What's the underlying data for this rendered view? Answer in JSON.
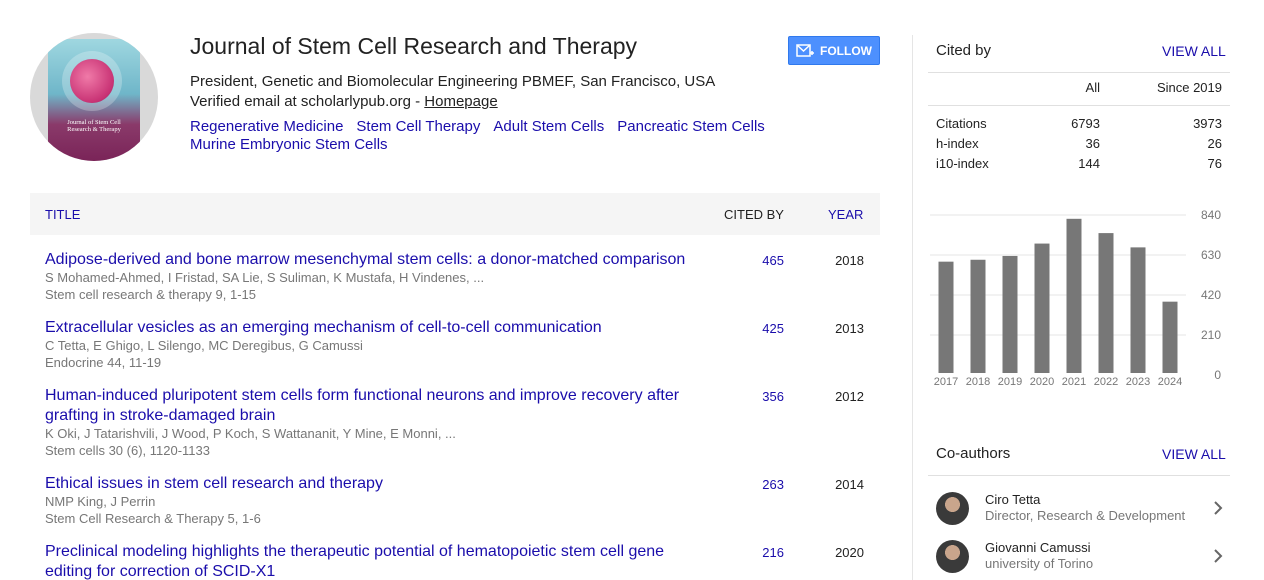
{
  "profile": {
    "name": "Journal of Stem Cell Research and Therapy",
    "affiliation": "President, Genetic and Biomolecular Engineering PBMEF, San Francisco, USA",
    "email_text": "Verified email at scholarlypub.org - ",
    "homepage_label": "Homepage",
    "cover_text": "Journal of Stem Cell Research & Therapy",
    "interests": [
      "Regenerative Medicine",
      "Stem Cell Therapy",
      "Adult Stem Cells",
      "Pancreatic Stem Cells",
      "Murine Embryonic Stem Cells"
    ],
    "follow_label": "FOLLOW"
  },
  "table": {
    "headers": {
      "title": "TITLE",
      "cited_by": "CITED BY",
      "year": "YEAR"
    },
    "rows": [
      {
        "title": "Adipose-derived and bone marrow mesenchymal stem cells: a donor-matched comparison",
        "authors": "S Mohamed-Ahmed, I Fristad, SA Lie, S Suliman, K Mustafa, H Vindenes, ...",
        "venue": "Stem cell research & therapy 9, 1-15",
        "cited": "465",
        "year": "2018"
      },
      {
        "title": "Extracellular vesicles as an emerging mechanism of cell-to-cell communication",
        "authors": "C Tetta, E Ghigo, L Silengo, MC Deregibus, G Camussi",
        "venue": "Endocrine 44, 11-19",
        "cited": "425",
        "year": "2013"
      },
      {
        "title": "Human-induced pluripotent stem cells form functional neurons and improve recovery after grafting in stroke-damaged brain",
        "authors": "K Oki, J Tatarishvili, J Wood, P Koch, S Wattananit, Y Mine, E Monni, ...",
        "venue": "Stem cells 30 (6), 1120-1133",
        "cited": "356",
        "year": "2012"
      },
      {
        "title": "Ethical issues in stem cell research and therapy",
        "authors": "NMP King, J Perrin",
        "venue": "Stem Cell Research & Therapy 5, 1-6",
        "cited": "263",
        "year": "2014"
      },
      {
        "title": "Preclinical modeling highlights the therapeutic potential of hematopoietic stem cell gene editing for correction of SCID-X1",
        "authors": "",
        "venue": "",
        "cited": "216",
        "year": "2020"
      }
    ]
  },
  "cited_by": {
    "title": "Cited by",
    "view_all": "VIEW ALL",
    "col_all": "All",
    "col_since": "Since 2019",
    "stats": [
      {
        "label": "Citations",
        "all": "6793",
        "since": "3973"
      },
      {
        "label": "h-index",
        "all": "36",
        "since": "26"
      },
      {
        "label": "i10-index",
        "all": "144",
        "since": "76"
      }
    ]
  },
  "chart_data": {
    "type": "bar",
    "categories": [
      "2017",
      "2018",
      "2019",
      "2020",
      "2021",
      "2022",
      "2023",
      "2024"
    ],
    "values": [
      595,
      605,
      625,
      690,
      820,
      745,
      670,
      385
    ],
    "yticks": [
      "840",
      "630",
      "420",
      "210",
      "0"
    ],
    "ylim": [
      0,
      840
    ],
    "bar_color": "#777777"
  },
  "coauthors": {
    "title": "Co-authors",
    "view_all": "VIEW ALL",
    "items": [
      {
        "name": "Ciro Tetta",
        "affiliation": "Director, Research & Development"
      },
      {
        "name": "Giovanni Camussi",
        "affiliation": "university of Torino"
      }
    ]
  }
}
